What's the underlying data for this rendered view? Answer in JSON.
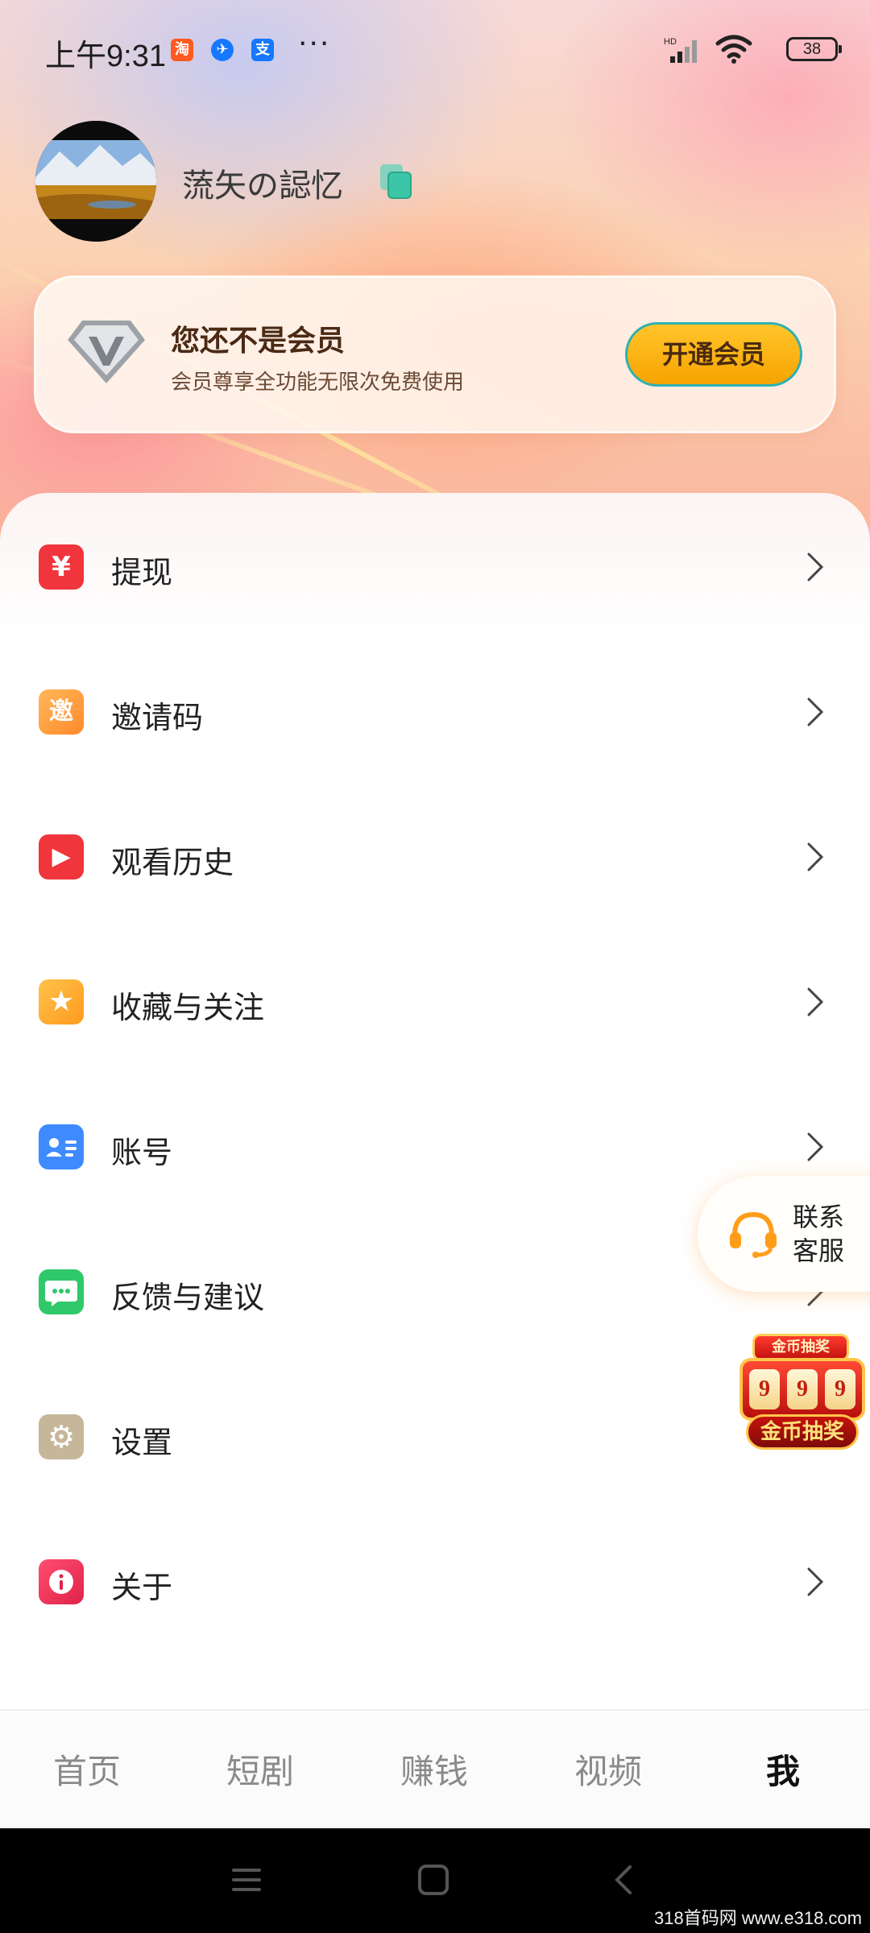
{
  "status_bar": {
    "time": "上午9:31",
    "app_icons": [
      {
        "name": "taobao-icon",
        "glyph": "淘",
        "color": "#ff5a1f"
      },
      {
        "name": "message-app-icon",
        "glyph": "✈",
        "color": "#1677ff"
      },
      {
        "name": "alipay-icon",
        "glyph": "支",
        "color": "#1677ff"
      }
    ],
    "more": "···",
    "network": "HD",
    "battery": "38"
  },
  "profile": {
    "username": "蓅矢の誋忆"
  },
  "vip": {
    "title": "您还不是会员",
    "subtitle": "会员尊享全功能无限次免费使用",
    "button": "开通会员"
  },
  "menu": {
    "items": [
      {
        "label": "提现",
        "icon": "yuan-icon",
        "glyph": "¥",
        "color": "#f0353c"
      },
      {
        "label": "邀请码",
        "icon": "invite-icon",
        "glyph": "邀",
        "color": "#ff9d3d"
      },
      {
        "label": "观看历史",
        "icon": "play-icon",
        "glyph": "▶",
        "color": "#f0353c"
      },
      {
        "label": "收藏与关注",
        "icon": "star-icon",
        "glyph": "★",
        "color": "#ffad2a"
      },
      {
        "label": "账号",
        "icon": "account-card-icon",
        "glyph": "",
        "color": "#3d8bff"
      },
      {
        "label": "反馈与建议",
        "icon": "feedback-icon",
        "glyph": "",
        "color": "#2fc86a"
      },
      {
        "label": "设置",
        "icon": "gear-icon",
        "glyph": "⚙",
        "color": "#c6b79a"
      },
      {
        "label": "关于",
        "icon": "info-icon",
        "glyph": "i",
        "color": "#ef2f5a"
      }
    ]
  },
  "customer_service": {
    "label": "联系客服"
  },
  "lottery": {
    "top_label": "金币抽奖",
    "digits": [
      "9",
      "9",
      "9"
    ],
    "label": "金币抽奖"
  },
  "bottom_nav": {
    "tabs": [
      {
        "label": "首页",
        "active": false
      },
      {
        "label": "短剧",
        "active": false
      },
      {
        "label": "赚钱",
        "active": false
      },
      {
        "label": "视频",
        "active": false
      },
      {
        "label": "我",
        "active": true
      }
    ]
  },
  "watermark": "318首码网 www.e318.com"
}
